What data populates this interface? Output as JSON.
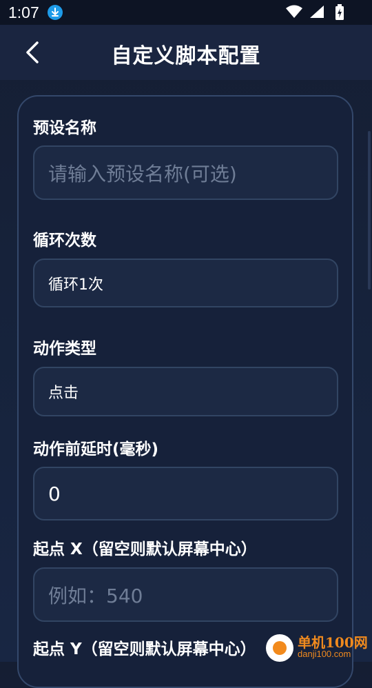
{
  "status_bar": {
    "time": "1:07",
    "icons": [
      "download-icon",
      "wifi-icon",
      "signal-icon",
      "battery-charging-icon"
    ]
  },
  "header": {
    "title": "自定义脚本配置",
    "back_icon": "chevron-left-icon"
  },
  "form": {
    "preset_name": {
      "label": "预设名称",
      "placeholder": "请输入预设名称(可选)",
      "value": ""
    },
    "loop_count": {
      "label": "循环次数",
      "value": "循环1次"
    },
    "action_type": {
      "label": "动作类型",
      "value": "点击"
    },
    "pre_delay": {
      "label": "动作前延时(毫秒)",
      "value": "0"
    },
    "start_x": {
      "label": "起点 X（留空则默认屏幕中心）",
      "placeholder": "例如：540",
      "value": ""
    },
    "start_y": {
      "label": "起点 Y（留空则默认屏幕中心）"
    }
  },
  "watermark": {
    "title": "单机100网",
    "url": "danji100.com"
  },
  "colors": {
    "background": "#16223a",
    "card_border": "#34486b",
    "input_bg": "#1c2944",
    "placeholder": "#6f7d96",
    "accent_download": "#1e9be8",
    "watermark": "#f08a1e"
  }
}
